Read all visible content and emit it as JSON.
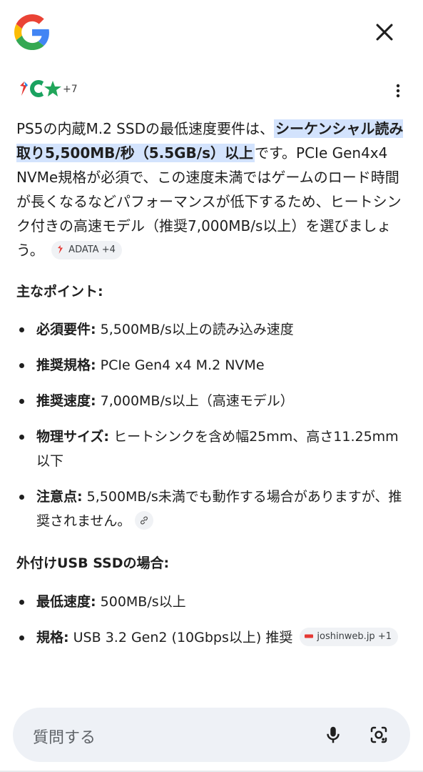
{
  "header": {
    "logo": "google-g-logo",
    "close_icon": "close-icon"
  },
  "sources": {
    "more_count": "+7",
    "menu_icon": "more-vert-icon"
  },
  "answer": {
    "text_before": "PS5の内蔵M.2 SSDの最低速度要件は、",
    "highlight": "シーケンシャル読み取り5,500MB/秒（5.5GB/s）以上",
    "text_after": "です。PCIe Gen4x4 NVMe規格が必須で、この速度未満ではゲームのロード時間が長くなるなどパフォーマンスが低下するため、ヒートシンク付きの高速モデル（推奨7,000MB/s以上）を選びましょう。",
    "citation_chip": "ADATA +4"
  },
  "main_points": {
    "title": "主なポイント:",
    "items": [
      {
        "label": "必須要件:",
        "text": " 5,500MB/s以上の読み込み速度"
      },
      {
        "label": "推奨規格:",
        "text": " PCIe Gen4 x4 M.2 NVMe"
      },
      {
        "label": "推奨速度:",
        "text": " 7,000MB/s以上（高速モデル）"
      },
      {
        "label": "物理サイズ:",
        "text": " ヒートシンクを含め幅25mm、高さ11.25mm以下"
      },
      {
        "label": "注意点:",
        "text": " 5,500MB/s未満でも動作する場合がありますが、推奨されません。"
      }
    ]
  },
  "usb_section": {
    "title": "外付けUSB SSDの場合:",
    "items": [
      {
        "label": "最低速度:",
        "text": " 500MB/s以上"
      },
      {
        "label": "規格:",
        "text": " USB 3.2 Gen2 (10Gbps以上) 推奨"
      }
    ],
    "citation_chip": "joshinweb.jp +1"
  },
  "ask_bar": {
    "placeholder": "質問する",
    "mic_icon": "mic-icon",
    "lens_icon": "google-lens-icon"
  },
  "colors": {
    "highlight": "#d3e3fd",
    "chip_bg": "#f0f2f5",
    "ask_bg": "#eef1f6"
  }
}
